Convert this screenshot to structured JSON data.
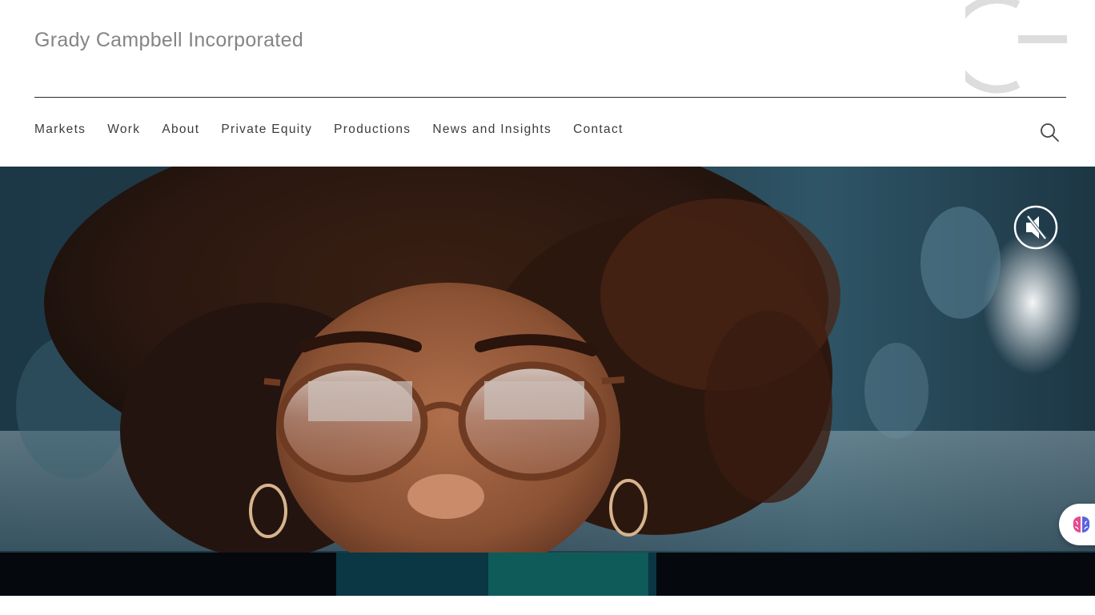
{
  "brand": {
    "name": "Grady Campbell Incorporated"
  },
  "nav": {
    "items": [
      "Markets",
      "Work",
      "About",
      "Private Equity",
      "Productions",
      "News and Insights",
      "Contact"
    ]
  },
  "header_icons": {
    "search": "search-icon",
    "logo": "logo-mark-icon"
  },
  "hero": {
    "media": "background-video",
    "mute_icon": "speaker-muted-icon",
    "assistant_icon": "brain-icon"
  },
  "colors": {
    "brand_text": "#858585",
    "nav_text": "#3c3c3c",
    "rule": "#2b2b2b",
    "logo_mark": "#dddddd"
  }
}
